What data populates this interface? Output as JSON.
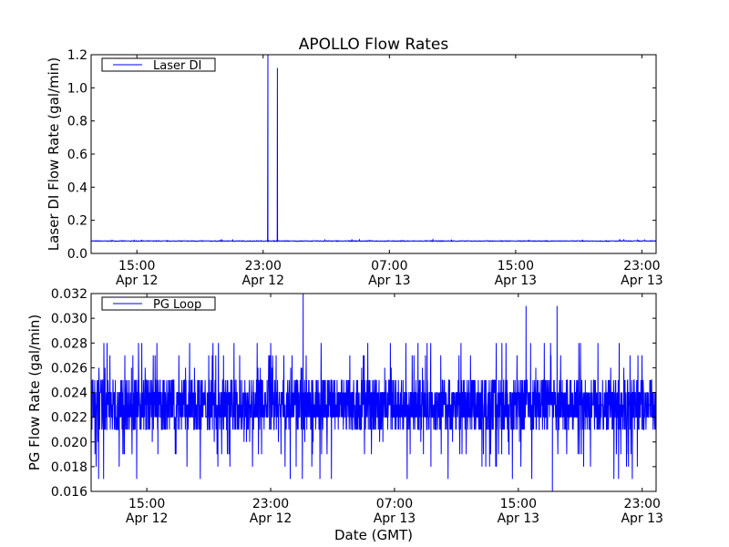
{
  "chart_data": [
    {
      "type": "line",
      "title": "APOLLO Flow Rates",
      "ylabel": "Laser DI Flow Rate (gal/min)",
      "xlabel": "",
      "ylim": [
        0,
        1.2
      ],
      "yticks": [
        "0.0",
        "0.2",
        "0.4",
        "0.6",
        "0.8",
        "1.0",
        "1.2"
      ],
      "xlim_hours_from_apr12": [
        12.1,
        47.9
      ],
      "xticks": [
        {
          "h": 15,
          "time": "15:00",
          "date": "Apr 12"
        },
        {
          "h": 23,
          "time": "23:00",
          "date": "Apr 12"
        },
        {
          "h": 31,
          "time": "07:00",
          "date": "Apr 13"
        },
        {
          "h": 39,
          "time": "15:00",
          "date": "Apr 13"
        },
        {
          "h": 47,
          "time": "23:00",
          "date": "Apr 13"
        }
      ],
      "legend": {
        "label": "Laser DI",
        "placement": "top-left"
      },
      "series": {
        "name": "Laser DI",
        "baseline": 0.075,
        "spikes": [
          {
            "h": 23.3,
            "v": 1.2
          },
          {
            "h": 23.9,
            "v": 1.12
          }
        ],
        "color": "#0000ff"
      }
    },
    {
      "type": "line",
      "title": "",
      "ylabel": "PG Flow Rate (gal/min)",
      "xlabel": "Date (GMT)",
      "ylim": [
        0.016,
        0.032
      ],
      "yticks": [
        "0.016",
        "0.018",
        "0.020",
        "0.022",
        "0.024",
        "0.026",
        "0.028",
        "0.030",
        "0.032"
      ],
      "xlim_hours_from_apr12": [
        11.4,
        47.9
      ],
      "xticks": [
        {
          "h": 15,
          "time": "15:00",
          "date": "Apr 12"
        },
        {
          "h": 23,
          "time": "23:00",
          "date": "Apr 12"
        },
        {
          "h": 31,
          "time": "07:00",
          "date": "Apr 13"
        },
        {
          "h": 39,
          "time": "15:00",
          "date": "Apr 13"
        },
        {
          "h": 47,
          "time": "23:00",
          "date": "Apr 13"
        }
      ],
      "legend": {
        "label": "PG Loop",
        "placement": "top-left"
      },
      "series": {
        "name": "PG Loop",
        "band": [
          0.021,
          0.025
        ],
        "typical_range": [
          0.017,
          0.028
        ],
        "peaks": [
          {
            "h": 25.1,
            "v": 0.032
          },
          {
            "h": 39.5,
            "v": 0.031
          },
          {
            "h": 41.5,
            "v": 0.031
          },
          {
            "h": 41.2,
            "v": 0.016
          }
        ],
        "color": "#0000ff"
      }
    }
  ]
}
